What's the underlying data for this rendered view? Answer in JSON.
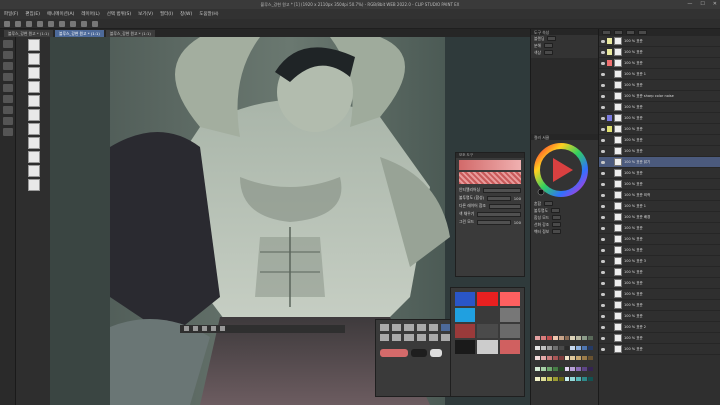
{
  "titlebar": {
    "text": "블루스_강현 원고 * [1] (1920 x 2110px 350dpi 50.7%) - RGB/8bit WEB 2022.0 - CLIP STUDIO PAINT EX",
    "buttons": [
      "—",
      "☐",
      "✕"
    ]
  },
  "menu": [
    "파일(F)",
    "편집(E)",
    "애니메이션(A)",
    "레이어(L)",
    "선택 범위(S)",
    "보기(V)",
    "필터(I)",
    "창(W)",
    "도움말(H)"
  ],
  "tabs": [
    {
      "label": "블루스_강현 원고 * (1:1)",
      "active": false
    },
    {
      "label": "블루스_강현 원고 * (1:1)",
      "active": true
    },
    {
      "label": "블루스_강현 원고 * (1:1)",
      "active": false
    }
  ],
  "float_panel": {
    "title": "보조 도구",
    "rows": [
      {
        "label": "안티앨리어싱",
        "value": ""
      },
      {
        "label": "불투명도 (합성)",
        "value": "100"
      },
      {
        "label": "다른 레이어 참조",
        "value": ""
      },
      {
        "label": "색 채우기",
        "value": ""
      },
      {
        "label": "그린 모드",
        "value": "100"
      }
    ]
  },
  "tool_property": {
    "title": "도구 속성",
    "rows": [
      "블렌딩",
      "분해",
      "색상"
    ]
  },
  "color_panel": {
    "title": "컬러 서클"
  },
  "layer_props": {
    "rows": [
      "혼합",
      "불투명도",
      "합성 모드",
      "선화 강조",
      "벡터 정보"
    ]
  },
  "layers": [
    {
      "name": "100 % 표준",
      "color": "#e9e9a0"
    },
    {
      "name": "100 % 표준",
      "color": "#e9e9a0"
    },
    {
      "name": "100 % 표준",
      "color": "#f07070"
    },
    {
      "name": "100 % 표준 1",
      "color": ""
    },
    {
      "name": "100 % 표준",
      "color": ""
    },
    {
      "name": "100 % 표준 sharp color noise",
      "color": ""
    },
    {
      "name": "100 % 표준",
      "color": ""
    },
    {
      "name": "100 % 표준",
      "color": "#7a7ae0"
    },
    {
      "name": "100 % 표준",
      "color": "#e0e070"
    },
    {
      "name": "100 % 표준",
      "color": ""
    },
    {
      "name": "100 % 표준",
      "color": ""
    },
    {
      "name": "100 % 표준 밝기",
      "color": "",
      "selected": true
    },
    {
      "name": "100 % 표준",
      "color": ""
    },
    {
      "name": "100 % 표준",
      "color": ""
    },
    {
      "name": "100 % 표준 외곽",
      "color": ""
    },
    {
      "name": "100 % 표준 1",
      "color": ""
    },
    {
      "name": "100 % 표준 배경",
      "color": ""
    },
    {
      "name": "100 % 표준",
      "color": ""
    },
    {
      "name": "100 % 표준",
      "color": ""
    },
    {
      "name": "100 % 표준",
      "color": ""
    },
    {
      "name": "100 % 표준 3",
      "color": ""
    },
    {
      "name": "100 % 표준",
      "color": ""
    },
    {
      "name": "100 % 표준",
      "color": ""
    },
    {
      "name": "100 % 표준",
      "color": ""
    },
    {
      "name": "100 % 표준",
      "color": ""
    },
    {
      "name": "100 % 표준",
      "color": ""
    },
    {
      "name": "100 % 표준 2",
      "color": ""
    },
    {
      "name": "100 % 표준",
      "color": ""
    },
    {
      "name": "100 % 표준",
      "color": ""
    }
  ],
  "colors": {
    "accent": "#4d6a9a",
    "selected_layer": "#4b5a7d",
    "canvas_bg": "#5d6b62",
    "fg_color": "#d46a6a",
    "bg_color": "#1e1e1e"
  },
  "swatches": [
    "#e5a2a2",
    "#d97d7d",
    "#c04e4e",
    "#f0c8b0",
    "#c9a58a",
    "#8a6b55",
    "#dcd2b8",
    "#b9b7a0",
    "#8c9c8a",
    "#5a6a5a",
    "#e6e6e6",
    "#bfbfbf",
    "#9a9a9a",
    "#707070",
    "#4a4a4a",
    "#2a2a2a",
    "#c7d9f0",
    "#8db0e0",
    "#4f76b0",
    "#243a66",
    "#f5dcdc",
    "#e3a9a9",
    "#cc7c7c",
    "#a85656",
    "#7e3c3c",
    "#f2e3c9",
    "#e0c79a",
    "#c8a56d",
    "#9c7c4b",
    "#6a5230",
    "#d6ecd6",
    "#a6d0a6",
    "#6fa86f",
    "#467c46",
    "#244a24",
    "#e0d4f0",
    "#b8a0d8",
    "#8b6cb5",
    "#5d4586",
    "#342352",
    "#f0f0c8",
    "#dcdc96",
    "#c2c25c",
    "#9a9a32",
    "#6a6a18",
    "#c8f0f0",
    "#92d8d8",
    "#58b8b8",
    "#2e8888",
    "#125252"
  ],
  "palette_popup": [
    "#2a56c8",
    "#e82020",
    "#ff6060",
    "#20a0e0",
    "#3a3a3a",
    "#777777",
    "#9a3a3a",
    "#4a4a4a",
    "#6a6a6a",
    "#1a1a1a",
    "#cccccc",
    "#d06060"
  ]
}
